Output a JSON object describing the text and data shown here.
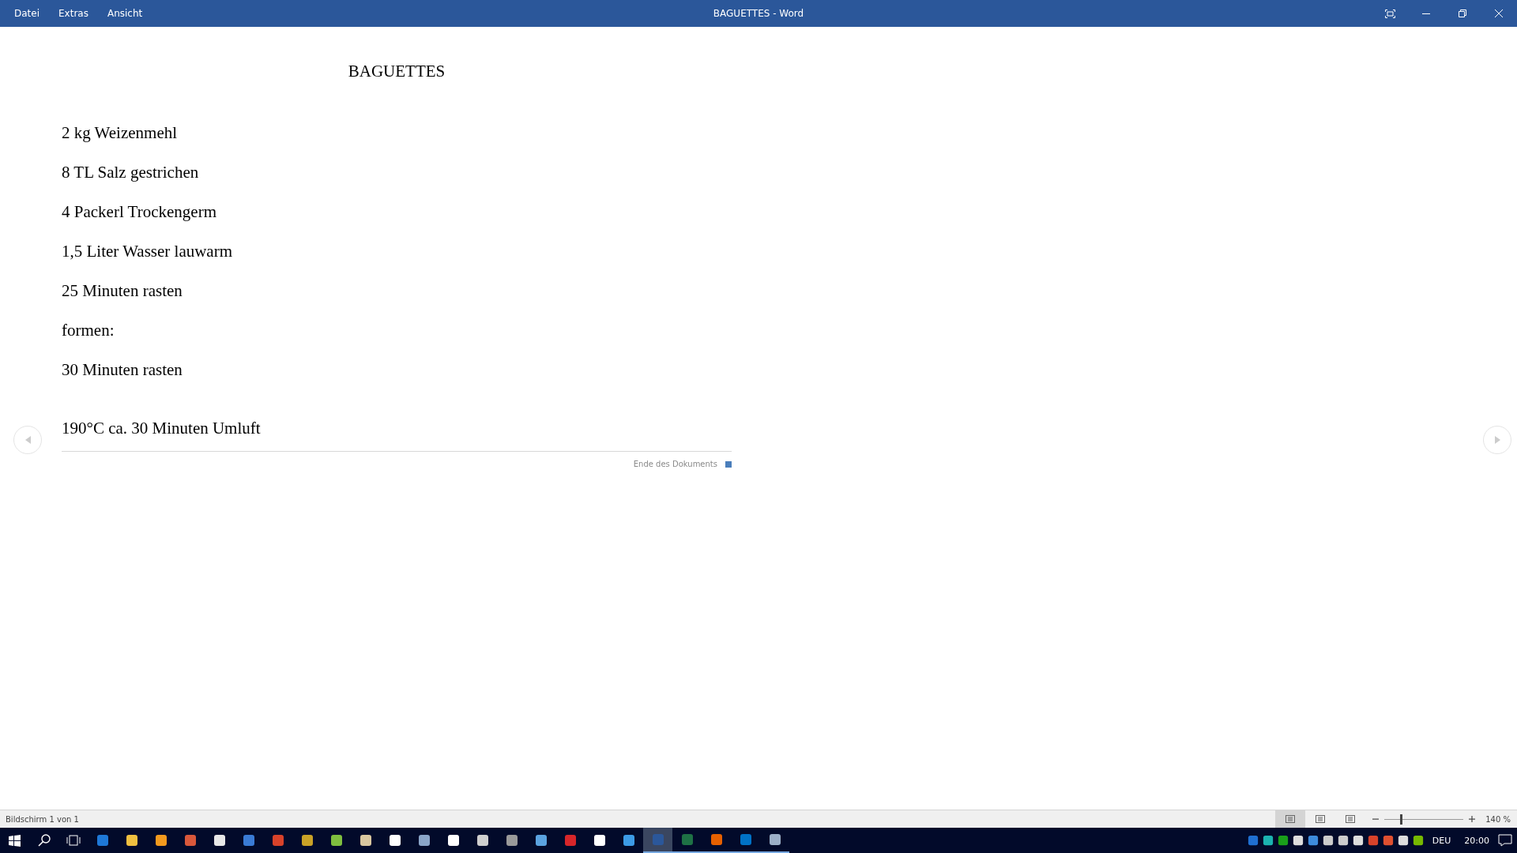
{
  "menu": [
    {
      "label": "Datei"
    },
    {
      "label": "Extras"
    },
    {
      "label": "Ansicht"
    }
  ],
  "window": {
    "title": "BAGUETTES  -  Word"
  },
  "document": {
    "title": "BAGUETTES",
    "paragraphs": [
      {
        "text": "2 kg Weizenmehl",
        "space_before": false
      },
      {
        "text": "8 TL Salz gestrichen",
        "space_before": false
      },
      {
        "text": "4 Packerl Trockengerm",
        "space_before": false
      },
      {
        "text": "1,5 Liter Wasser lauwarm",
        "space_before": false
      },
      {
        "text": "25 Minuten rasten",
        "space_before": false
      },
      {
        "text": "formen:",
        "space_before": false
      },
      {
        "text": "30 Minuten rasten",
        "space_before": false
      },
      {
        "text": "190°C ca. 30 Minuten Umluft",
        "space_before": true
      }
    ],
    "end_label": "Ende des Dokuments"
  },
  "status_bar": {
    "page": "Bildschirm 1 von 1",
    "views": [
      {
        "selected": true
      },
      {
        "selected": false
      },
      {
        "selected": false
      }
    ],
    "zoom": {
      "level": 0.21,
      "reading": "140 %"
    }
  },
  "taskbar": {
    "apps": [
      {
        "running": false,
        "selected": false
      },
      {
        "running": false,
        "selected": false
      },
      {
        "running": false,
        "selected": false
      },
      {
        "running": false,
        "selected": false
      },
      {
        "running": false,
        "selected": false
      },
      {
        "running": false,
        "selected": false
      },
      {
        "running": false,
        "selected": false
      },
      {
        "running": false,
        "selected": false
      },
      {
        "running": false,
        "selected": false
      },
      {
        "running": false,
        "selected": false
      },
      {
        "running": false,
        "selected": false
      },
      {
        "running": false,
        "selected": false
      },
      {
        "running": false,
        "selected": false
      },
      {
        "running": false,
        "selected": false
      },
      {
        "running": false,
        "selected": false
      },
      {
        "running": false,
        "selected": false
      },
      {
        "running": false,
        "selected": false
      },
      {
        "running": false,
        "selected": false
      },
      {
        "running": false,
        "selected": false
      },
      {
        "running": true,
        "selected": true
      },
      {
        "running": true,
        "selected": false
      },
      {
        "running": true,
        "selected": false
      },
      {
        "running": true,
        "selected": false
      },
      {
        "running": true,
        "selected": false
      }
    ],
    "language": "DEU",
    "time": "20:00"
  }
}
